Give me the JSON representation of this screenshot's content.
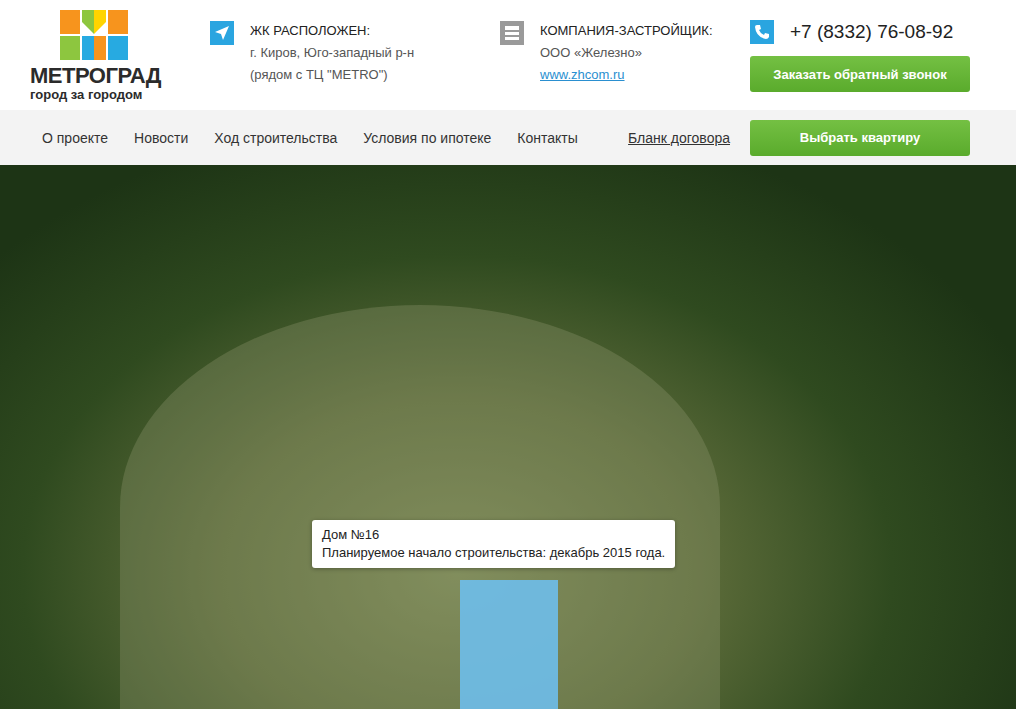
{
  "logo": {
    "title": "МЕТРОГРАД",
    "subtitle": "город за городом"
  },
  "info": [
    {
      "kind": "location",
      "label": "ЖК РАСПОЛОЖЕН:",
      "lines": [
        "г. Киров, Юго-западный р-н",
        "(рядом с ТЦ \"METRO\")"
      ],
      "link": ""
    },
    {
      "kind": "company",
      "label": "КОМПАНИЯ-ЗАСТРОЙЩИК:",
      "lines": [
        "ООО «Железно»"
      ],
      "link": "www.zhcom.ru"
    }
  ],
  "phone": "+7 (8332) 76-08-92",
  "callback_button": "Заказать обратный звонок",
  "nav": [
    "О проекте",
    "Новости",
    "Ход строительства",
    "Условия по ипотеке",
    "Контакты"
  ],
  "contract_link": "Бланк договора",
  "choose_button": "Выбрать квартиру",
  "hero": {
    "tooltip": {
      "title": "Дом №16",
      "text": "Планируемое начало строительства: декабрь 2015 года."
    }
  }
}
